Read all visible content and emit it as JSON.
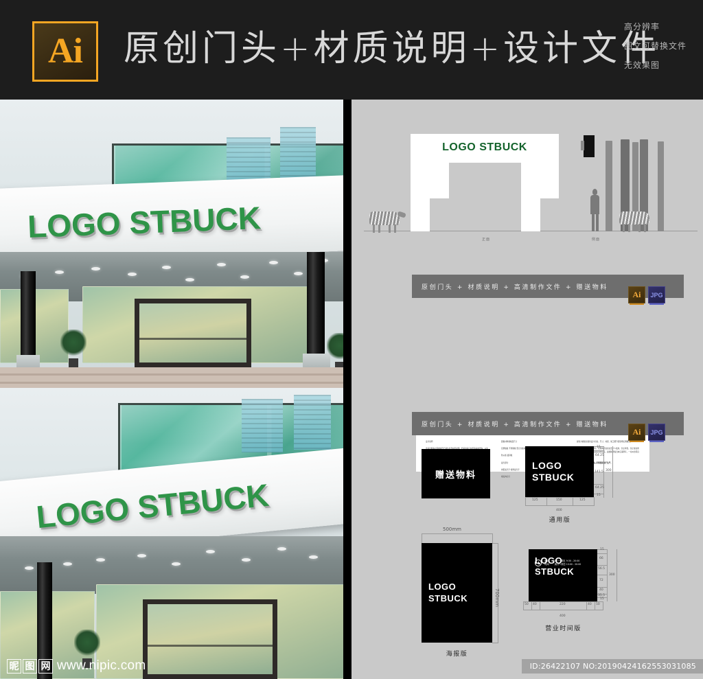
{
  "header": {
    "logo_text": "Ai",
    "logo_name": "illustrator-logo",
    "title": "原创门头+材质说明+设计文件",
    "notes": [
      "高分辨率",
      "图文可替换文件",
      "无效果图"
    ]
  },
  "photos": {
    "sign_text": "LOGO STBUCK",
    "watermark": {
      "cn_chars": [
        "昵",
        "图",
        "网"
      ],
      "url": "www.nipic.com"
    }
  },
  "elevation": {
    "gate_sign_text": "LOGO STBUCK",
    "front_label": "正面",
    "side_label": "侧面"
  },
  "banners": [
    {
      "text": "原创门头 + 材质说明 + 高清制作文件 + 赠送物料",
      "badges": [
        {
          "label": "Ai",
          "name": "ai-file-badge"
        },
        {
          "label": "JPG",
          "name": "jpg-file-badge"
        }
      ]
    },
    {
      "text": "原创门头 + 材质说明 + 高清制作文件 + 赠送物料",
      "badges": [
        {
          "label": "Ai",
          "name": "ai-file-badge"
        },
        {
          "label": "JPG",
          "name": "jpg-file-badge"
        }
      ]
    }
  ],
  "spec_panel": {
    "columns": [
      {
        "heading": "文件说明",
        "paragraphs": [
          "设计说明",
          "该设计稿客户需求项目产品信息及材质说明，若采用其它材质请来电咨询，以免印刷造成损失。",
          "设计文件",
          "本文件未含有字体，文字文件已转为曲线建议使用，如文字出现乱码请咨询客服，请勿必然确认无误后再进行印刷生产。"
        ],
        "emphasis_index": -1
      },
      {
        "heading": "材质说明",
        "paragraphs": [
          "面板材料规格及尺寸",
          "铝塑板板    不锈钢板    亚克力板材",
          "防火板    镀锌板",
          "发光部分",
          "树脂发光字   吸塑发光字",
          "喷绘内打灯"
        ],
        "emphasis_index": -1
      },
      {
        "heading": "免责说明",
        "paragraphs": [
          "提供方模板仅提供设计方案，尺寸、材质、施工细节需现场实测确认。",
          "本模板版权归本店铺所有，仅限购买者商业及个人使用，禁止转售。禁止擅自修改后二次销售，违者将追究法律责任，最终解释权归本店铺所有，一切纠纷须自行承担相关责任。",
          "本文件仅作为参考素材，不得直接用于生产。"
        ],
        "emphasis_index": 2
      }
    ]
  },
  "materials": {
    "gift_card": {
      "label": "赠送物料"
    },
    "general": {
      "logo_line1": "LOGO",
      "logo_line2": "STBUCK",
      "caption": "通用版",
      "width_dims": [
        "125",
        "150",
        "125"
      ],
      "width_total": "400",
      "height_dims": [
        "15",
        "64.25",
        "141.5",
        "64.25",
        "15"
      ],
      "height_total": "300"
    },
    "poster": {
      "logo_line1": "LOGO",
      "logo_line2": "STBUCK",
      "caption": "海报版",
      "width_label": "500mm",
      "height_label": "700mm"
    },
    "hours": {
      "logo_line1": "LOGO",
      "logo_line2": "STBUCK",
      "caption": "营业时间版",
      "hours_label_line1": "营业",
      "hours_label_line2": "时间",
      "row1": "周一～周五    9:30 - 20:00",
      "row2": "周六～周日    10:00 - 20:00",
      "width_dims": [
        "50",
        "40",
        "220",
        "40",
        "50"
      ],
      "width_total": "400",
      "height_dims": [
        "15",
        "66",
        "56.5",
        "72",
        "40",
        "35.5",
        "15"
      ],
      "height_total": "300"
    }
  },
  "footer": {
    "id_text": "ID:26422107 NO:20190424162553031085"
  },
  "colors": {
    "header_bg": "#1d1d1d",
    "accent_orange": "#f5a623",
    "logo_green": "#2f9448",
    "gate_green": "#14632c",
    "panel_gray": "#c9c9c9",
    "banner_gray": "#6e6e6e"
  }
}
